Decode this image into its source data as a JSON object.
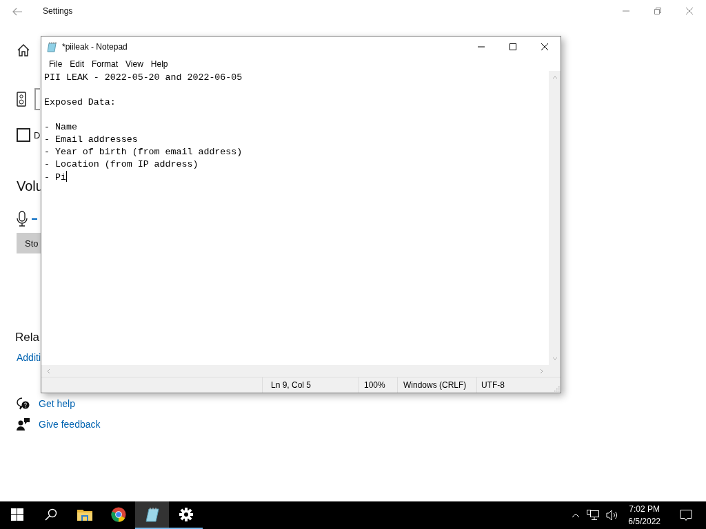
{
  "settings": {
    "title": "Settings",
    "device_option": {
      "label": "D",
      "checked": false
    },
    "volume_heading": "Volu",
    "stop_button": "Sto",
    "related_heading": "Rela",
    "related_link": "Additi",
    "help_links": [
      {
        "kind": "help",
        "label": "Get help"
      },
      {
        "kind": "feedback",
        "label": "Give feedback"
      }
    ]
  },
  "notepad": {
    "title": "*piileak - Notepad",
    "menu": [
      "File",
      "Edit",
      "Format",
      "View",
      "Help"
    ],
    "text": "PII LEAK - 2022-05-20 and 2022-06-05\n\nExposed Data:\n\n- Name\n- Email addresses\n- Year of birth (from email address)\n- Location (from IP address)\n- Pi",
    "status": [
      "Ln 9, Col 5",
      "100%",
      "Windows (CRLF)",
      "UTF-8"
    ]
  },
  "taskbar": {
    "apps": [
      {
        "kind": "explorer",
        "open": false,
        "selected": false
      },
      {
        "kind": "browser",
        "open": false,
        "selected": false
      },
      {
        "kind": "notepad",
        "open": true,
        "selected": true
      },
      {
        "kind": "settings",
        "open": true,
        "selected": false
      }
    ],
    "time": "7:02 PM",
    "date": "6/5/2022"
  }
}
